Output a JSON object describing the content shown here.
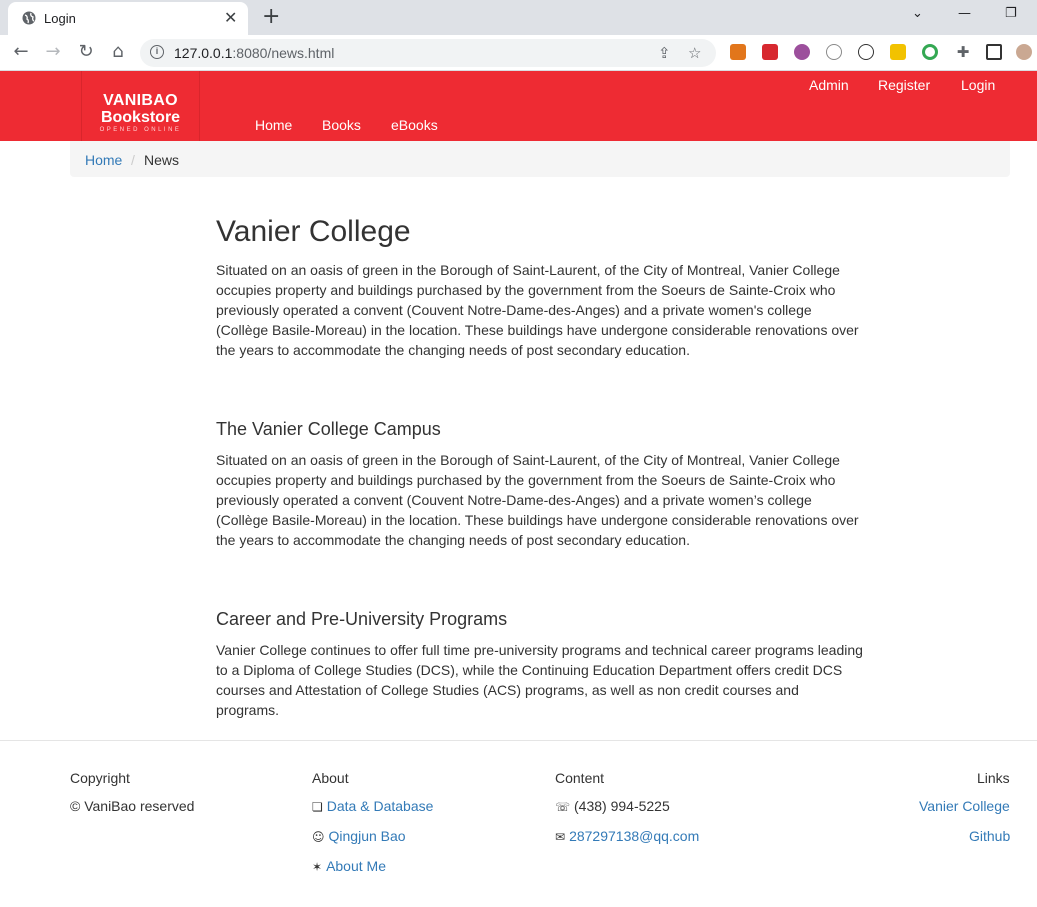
{
  "browser": {
    "tab_title": "Login",
    "url_host": "127.0.0.1",
    "url_rest": ":8080/news.html"
  },
  "site": {
    "brand_line1": "VANIBAO",
    "brand_line2": "Bookstore",
    "brand_tagline": "OPENED ONLINE",
    "brand_color": "#ee2b33",
    "top_links": [
      "Admin",
      "Register",
      "Login"
    ],
    "nav_links": [
      "Home",
      "Books",
      "eBooks"
    ]
  },
  "breadcrumb": {
    "home": "Home",
    "separator": "/",
    "current": "News"
  },
  "article": {
    "title": "Vanier College",
    "intro_lines": [
      "Situated on an oasis of green in the Borough of Saint-Laurent, of the City of Montreal, Vanier College",
      "occupies property and buildings purchased by the government from the Soeurs de Sainte-Croix who",
      "previously operated a convent (Couvent Notre-Dame-des-Anges) and a private women's college",
      "(Collège Basile-Moreau) in the location. These buildings have undergone considerable renovations over",
      "the years to accommodate the changing needs of post secondary education."
    ],
    "sections": [
      {
        "heading": "The Vanier College Campus",
        "lines": [
          "Situated on an oasis of green in the Borough of Saint-Laurent, of the City of Montreal, Vanier College",
          "occupies property and buildings purchased by the government from the Soeurs de Sainte-Croix who",
          "previously operated a convent (Couvent Notre-Dame-des-Anges) and a private women’s college",
          "(Collège Basile-Moreau) in the location. These buildings have undergone considerable renovations over",
          "the years to accommodate the changing needs of post secondary education."
        ]
      },
      {
        "heading": "Career and Pre-University Programs",
        "lines": [
          "Vanier College continues to offer full time pre-university programs and technical career programs leading",
          "to a Diploma of College Studies (DCS), while the Continuing Education Department offers credit DCS",
          "courses and Attestation of College Studies (ACS) programs, as well as non credit courses and",
          "programs."
        ]
      }
    ]
  },
  "footer": {
    "copyright": {
      "heading": "Copyright",
      "text": "© VaniBao reserved"
    },
    "about": {
      "heading": "About",
      "items": [
        {
          "glyph": "❏",
          "label": "Data & Database"
        },
        {
          "glyph": "☺",
          "label": "Qingjun Bao"
        },
        {
          "glyph": "✶",
          "label": "About Me"
        }
      ]
    },
    "content": {
      "heading": "Content",
      "phone_glyph": "☏",
      "phone": "(438) 994-5225",
      "mail_glyph": "✉",
      "email": "287297138@qq.com"
    },
    "links": {
      "heading": "Links",
      "items": [
        "Vanier College",
        "Github"
      ]
    }
  }
}
